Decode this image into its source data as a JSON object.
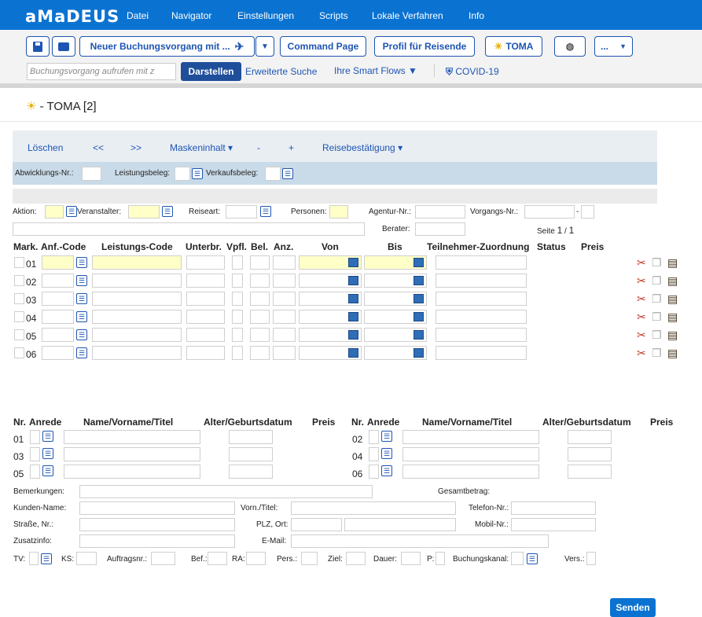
{
  "app": {
    "logo": "aMaDEUS"
  },
  "menu": [
    "Datei",
    "Navigator",
    "Einstellungen",
    "Scripts",
    "Lokale Verfahren",
    "Info"
  ],
  "toolbar": {
    "new_booking": "Neuer Buchungsvorgang mit ...",
    "command_page": "Command Page",
    "profile": "Profil für Reisende",
    "toma": "TOMA",
    "more": "...",
    "search_placeholder": "Buchungsvorgang aufrufen mit z",
    "display": "Darstellen",
    "advanced": "Erweiterte Suche",
    "smart_flows": "Ihre Smart Flows",
    "covid": "COVID-19"
  },
  "page": {
    "title": "- TOMA [2]"
  },
  "actions": {
    "delete": "Löschen",
    "prev": "<<",
    "next": ">>",
    "mask": "Maskeninhalt",
    "minus": "-",
    "plus": "+",
    "confirm": "Reisebestätigung"
  },
  "sub": {
    "abw": "Abwicklungs-Nr.:",
    "leist": "Leistungsbeleg:",
    "verk": "Verkaufsbeleg:"
  },
  "form": {
    "aktion": "Aktion:",
    "veranst": "Veranstalter:",
    "reiseart": "Reiseart:",
    "personen": "Personen:",
    "agentur": "Agentur-Nr.:",
    "vorgang": "Vorgangs-Nr.:",
    "dash": "-",
    "berater": "Berater:",
    "seite": "Seite",
    "page_cur": "1",
    "page_sep": "/",
    "page_total": "1"
  },
  "service_headers": [
    "Mark.",
    "Anf.-Code",
    "Leistungs-Code",
    "Unterbr.",
    "Vpfl.",
    "Bel.",
    "Anz.",
    "Von",
    "Bis",
    "Teilnehmer-Zuordnung",
    "Status",
    "Preis"
  ],
  "service_rows": [
    "01",
    "02",
    "03",
    "04",
    "05",
    "06"
  ],
  "traveler_headers": [
    "Nr.",
    "Anrede",
    "Name/Vorname/Titel",
    "Alter/Geburtsdatum",
    "Preis"
  ],
  "traveler_left": [
    "01",
    "03",
    "05"
  ],
  "traveler_right": [
    "02",
    "04",
    "06"
  ],
  "customer": {
    "bemerk": "Bemerkungen:",
    "gesamt": "Gesamtbetrag:",
    "kunde": "Kunden-Name:",
    "vorn": "Vorn./Titel:",
    "telefon": "Telefon-Nr.:",
    "strasse": "Straße, Nr.:",
    "plz": "PLZ, Ort:",
    "mobil": "Mobil-Nr.:",
    "zusatz": "Zusatzinfo:",
    "email": "E-Mail:"
  },
  "bottom": {
    "tv": "TV:",
    "ks": "KS:",
    "auftrag": "Auftragsnr.:",
    "bef": "Bef.:",
    "ra": "RA:",
    "pers": "Pers.:",
    "ziel": "Ziel:",
    "dauer": "Dauer:",
    "p": "P:",
    "kanal": "Buchungskanal:",
    "vers": "Vers.:"
  },
  "send": "Senden"
}
